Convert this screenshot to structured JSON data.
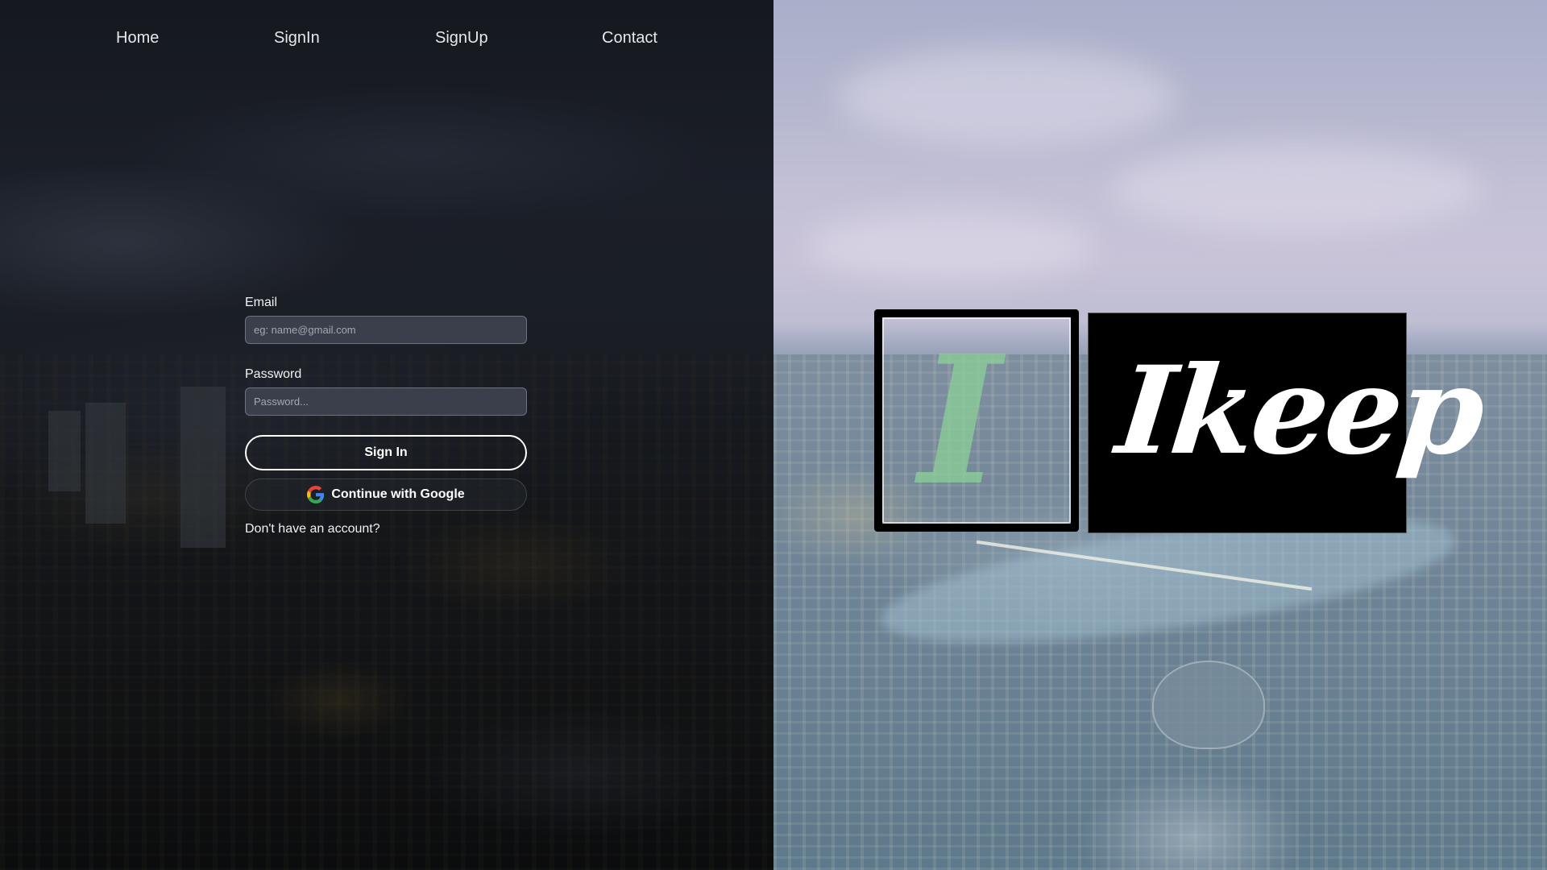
{
  "nav": {
    "links": [
      {
        "label": "Home"
      },
      {
        "label": "SignIn"
      },
      {
        "label": "SignUp"
      },
      {
        "label": "Contact"
      }
    ]
  },
  "signin_form": {
    "email_label": "Email",
    "email_placeholder": "eg: name@gmail.com",
    "email_value": "",
    "password_label": "Password",
    "password_placeholder": "Password...",
    "password_value": "",
    "signin_button": "Sign In",
    "google_button": "Continue with Google",
    "google_icon": "google-g-icon",
    "no_account_text": "Don't have an account?"
  },
  "brand": {
    "logo_letter": "I",
    "logo_word": "Ikeep",
    "letter_color": "#8cd296"
  },
  "colors": {
    "left_panel": "#15181f",
    "input_background": "#3a3f4b",
    "button_border": "#ffffff",
    "text": "#f1f3f6"
  }
}
